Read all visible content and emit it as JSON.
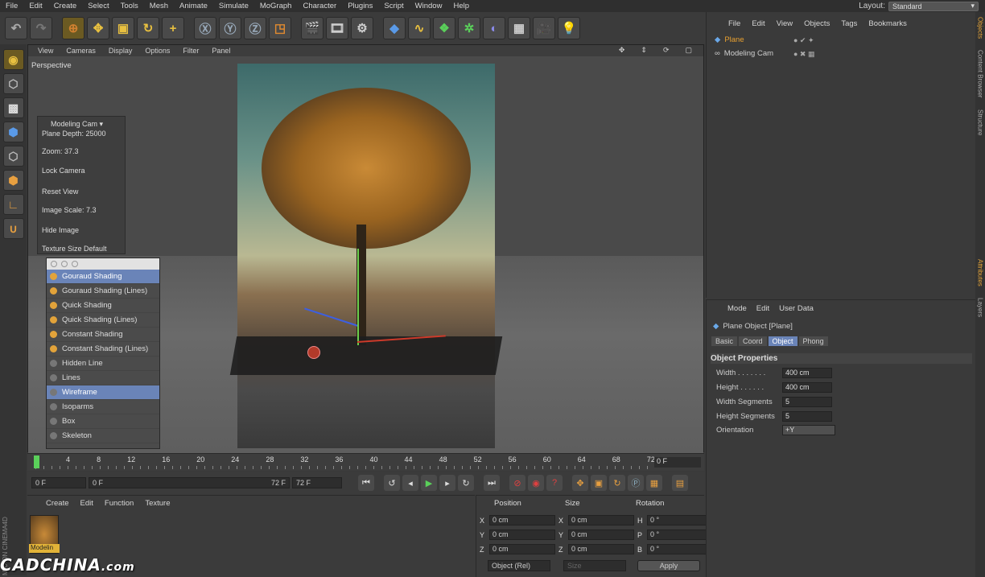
{
  "menubar": [
    "File",
    "Edit",
    "Create",
    "Select",
    "Tools",
    "Mesh",
    "Animate",
    "Simulate",
    "MoGraph",
    "Character",
    "Plugins",
    "Script",
    "Window",
    "Help"
  ],
  "layout": {
    "label": "Layout:",
    "value": "Standard"
  },
  "viewport": {
    "menu": [
      "View",
      "Cameras",
      "Display",
      "Options",
      "Filter",
      "Panel"
    ],
    "label": "Perspective"
  },
  "campanel": {
    "title": "Modeling Cam",
    "plane_depth": "Plane Depth:   25000",
    "zoom": "Zoom:   37.3",
    "lock": "Lock Camera",
    "reset": "Reset View",
    "image_scale": "Image Scale:   7.3",
    "hide": "Hide Image",
    "texture_size": "Texture Size   Default"
  },
  "shading_menu": [
    {
      "label": "Gouraud Shading",
      "selected": true
    },
    {
      "label": "Gouraud Shading (Lines)",
      "selected": false
    },
    {
      "label": "Quick Shading",
      "selected": false
    },
    {
      "label": "Quick Shading (Lines)",
      "selected": false
    },
    {
      "label": "Constant Shading",
      "selected": false
    },
    {
      "label": "Constant Shading (Lines)",
      "selected": false
    },
    {
      "label": "Hidden Line",
      "selected": false
    },
    {
      "label": "Lines",
      "selected": false
    },
    {
      "label": "Wireframe",
      "selected": true
    },
    {
      "label": "Isoparms",
      "selected": false
    },
    {
      "label": "Box",
      "selected": false
    },
    {
      "label": "Skeleton",
      "selected": false
    }
  ],
  "timeline": {
    "ticks": [
      "0",
      "4",
      "8",
      "12",
      "16",
      "20",
      "24",
      "28",
      "32",
      "36",
      "40",
      "44",
      "48",
      "52",
      "56",
      "60",
      "64",
      "68",
      "72"
    ],
    "current": "0 F"
  },
  "transport": {
    "start": "0 F",
    "range_start": "0 F",
    "range_end": "72 F",
    "end": "72 F"
  },
  "materials": {
    "menu": [
      "Create",
      "Edit",
      "Function",
      "Texture"
    ],
    "item": "Modelin"
  },
  "coords": {
    "headers": [
      "Position",
      "Size",
      "Rotation"
    ],
    "rows": [
      {
        "a": "X",
        "pos": "0 cm",
        "b": "X",
        "size": "0 cm",
        "c": "H",
        "rot": "0 °"
      },
      {
        "a": "Y",
        "pos": "0 cm",
        "b": "Y",
        "size": "0 cm",
        "c": "P",
        "rot": "0 °"
      },
      {
        "a": "Z",
        "pos": "0 cm",
        "b": "Z",
        "size": "0 cm",
        "c": "B",
        "rot": "0 °"
      }
    ],
    "mode": "Object (Rel)",
    "size_mode": "Size",
    "apply": "Apply"
  },
  "objects": {
    "menu": [
      "File",
      "Edit",
      "View",
      "Objects",
      "Tags",
      "Bookmarks"
    ],
    "items": [
      "Plane",
      "Modeling Cam"
    ]
  },
  "attributes": {
    "menu": [
      "Mode",
      "Edit",
      "User Data"
    ],
    "title": "Plane Object [Plane]",
    "tabs": [
      "Basic",
      "Coord",
      "Object",
      "Phong"
    ],
    "section": "Object Properties",
    "props": [
      {
        "label": "Width . . . . . . .",
        "value": "400 cm"
      },
      {
        "label": "Height . . . . . .",
        "value": "400 cm"
      },
      {
        "label": "Width Segments",
        "value": "5"
      },
      {
        "label": "Height Segments",
        "value": "5"
      },
      {
        "label": "Orientation",
        "value": "+Y"
      }
    ]
  },
  "sidetabs": [
    "Objects",
    "Content Browser",
    "Structure",
    "Attributes",
    "Layers"
  ],
  "branding": {
    "maxon": "MAXON CINEMA4D",
    "watermark": "CADCHINA",
    "watermark_suffix": ".com"
  }
}
